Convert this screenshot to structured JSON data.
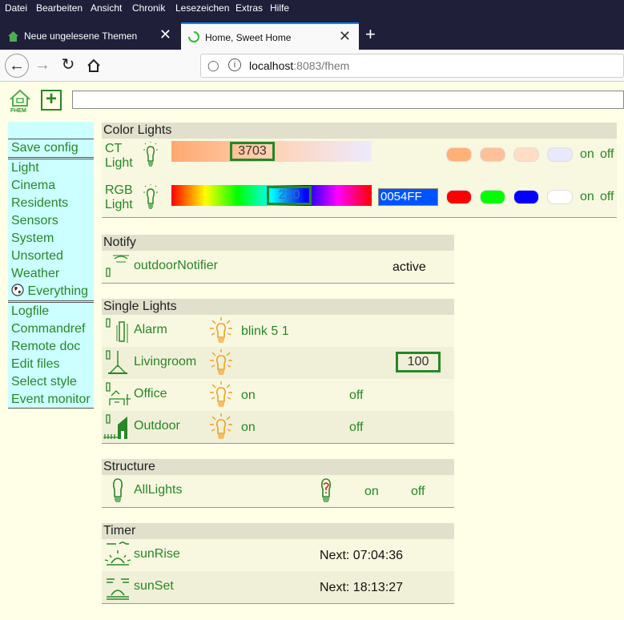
{
  "browser": {
    "menu": [
      "Datei",
      "Bearbeiten",
      "Ansicht",
      "Chronik",
      "Lesezeichen",
      "Extras",
      "Hilfe"
    ],
    "tabs": [
      {
        "title": "Neue ungelesene Themen"
      },
      {
        "title": "Home, Sweet Home"
      }
    ],
    "url_host": "localhost",
    "url_rest": ":8083/fhem",
    "tab_close": "✕",
    "new_tab": "+"
  },
  "menu": {
    "save": "Save config",
    "rooms": [
      "Light",
      "Cinema",
      "Residents",
      "Sensors",
      "System",
      "Unsorted",
      "Weather",
      "Everything"
    ],
    "tools": [
      "Logfile",
      "Commandref",
      "Remote doc",
      "Edit files",
      "Select style",
      "Event monitor"
    ]
  },
  "color_lights": {
    "title": "Color Lights",
    "ct": {
      "name_line1": "CT",
      "name_line2": "Light",
      "value": "3703",
      "on": "on",
      "off": "off",
      "swatches": [
        "#ffb077",
        "#ffc09a",
        "#ffdcc4",
        "#e8e8ff"
      ]
    },
    "rgb": {
      "name_line1": "RGB",
      "name_line2": "Light",
      "value": "220",
      "hex": "0054FF",
      "on": "on",
      "off": "off",
      "swatches": [
        "#ff0000",
        "#00ff00",
        "#0000ff",
        "#ffffff"
      ]
    }
  },
  "notify": {
    "title": "Notify",
    "name": "outdoorNotifier",
    "state": "active"
  },
  "single_lights": {
    "title": "Single Lights",
    "rows": [
      {
        "name": "Alarm",
        "state": "blink 5 1"
      },
      {
        "name": "Livingroom",
        "value": "100"
      },
      {
        "name": "Office",
        "on": "on",
        "off": "off"
      },
      {
        "name": "Outdoor",
        "on": "on",
        "off": "off"
      }
    ]
  },
  "structure": {
    "title": "Structure",
    "name": "AllLights",
    "on": "on",
    "off": "off"
  },
  "timer": {
    "title": "Timer",
    "rows": [
      {
        "name": "sunRise",
        "next": "Next: 07:04:36"
      },
      {
        "name": "sunSet",
        "next": "Next: 18:13:27"
      }
    ]
  }
}
